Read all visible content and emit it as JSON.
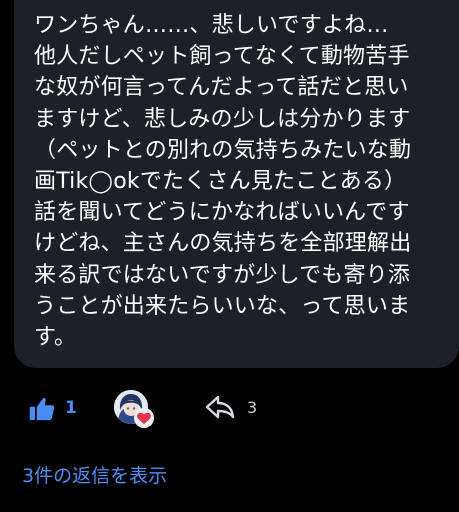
{
  "comment": {
    "lines": [
      "ワンちゃん……、悲しいですよね…",
      "他人だしペット飼ってなくて動物苦手",
      "な奴が何言ってんだよって話だと思い",
      "ますけど、悲しみの少しは分かります",
      "（ペットとの別れの気持ちみたいな動",
      "画Tik◯okでたくさん見たことある）",
      "話を聞いてどうにかなればいいんです",
      "けどね、主さんの気持ちを全部理解出",
      "来る訳ではないですが少しでも寄り添",
      "うことが出来たらいいな、って思いま",
      "す。"
    ]
  },
  "actions": {
    "like_count": "1",
    "reply_count": "3",
    "like_icon": "thumbs-up-icon",
    "reply_icon": "reply-arrow-icon",
    "reaction_icon": "heart-icon"
  },
  "footer": {
    "show_replies_label": "3件の返信を表示"
  },
  "colors": {
    "background": "#000000",
    "bubble": "#1e2028",
    "accent": "#4a8ef5",
    "heart": "#e8334a",
    "text": "#ffffff",
    "muted": "#c8ccd4"
  }
}
